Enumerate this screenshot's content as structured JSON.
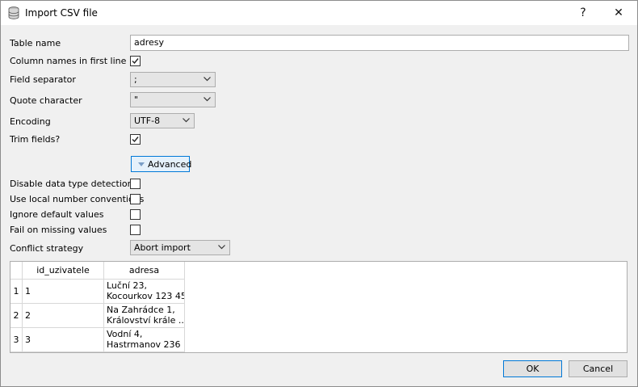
{
  "window": {
    "title": "Import CSV file",
    "help_glyph": "?",
    "close_glyph": "✕"
  },
  "form": {
    "table_name_label": "Table name",
    "table_name_value": "adresy",
    "column_names_label": "Column names in first line",
    "column_names_checked": true,
    "field_separator_label": "Field separator",
    "field_separator_value": ";",
    "quote_character_label": "Quote character",
    "quote_character_value": "\"",
    "encoding_label": "Encoding",
    "encoding_value": "UTF-8",
    "trim_fields_label": "Trim fields?",
    "trim_fields_checked": true,
    "advanced_label": "Advanced",
    "disable_detection_label": "Disable data type detection",
    "local_number_label": "Use local number conventions",
    "ignore_defaults_label": "Ignore default values",
    "fail_missing_label": "Fail on missing values",
    "conflict_strategy_label": "Conflict strategy",
    "conflict_strategy_value": "Abort import"
  },
  "preview": {
    "columns": [
      "id_uzivatele",
      "adresa"
    ],
    "rows": [
      {
        "num": "1",
        "id": "1",
        "adresa_l1": "Luční 23,",
        "adresa_l2": "Kocourkov 123 45"
      },
      {
        "num": "2",
        "id": "2",
        "adresa_l1": "Na Zahrádce 1,",
        "adresa_l2": "Království krále ..."
      },
      {
        "num": "3",
        "id": "3",
        "adresa_l1": "Vodní 4,",
        "adresa_l2": "Hastrmanov 236 ..."
      }
    ]
  },
  "buttons": {
    "ok": "OK",
    "cancel": "Cancel"
  },
  "icons": {
    "app": "database-icon",
    "dropdown": "chevron-down-icon",
    "check": "checkmark-icon"
  },
  "colors": {
    "accent": "#0078d7",
    "advanced_bg": "#e5f1fb"
  }
}
